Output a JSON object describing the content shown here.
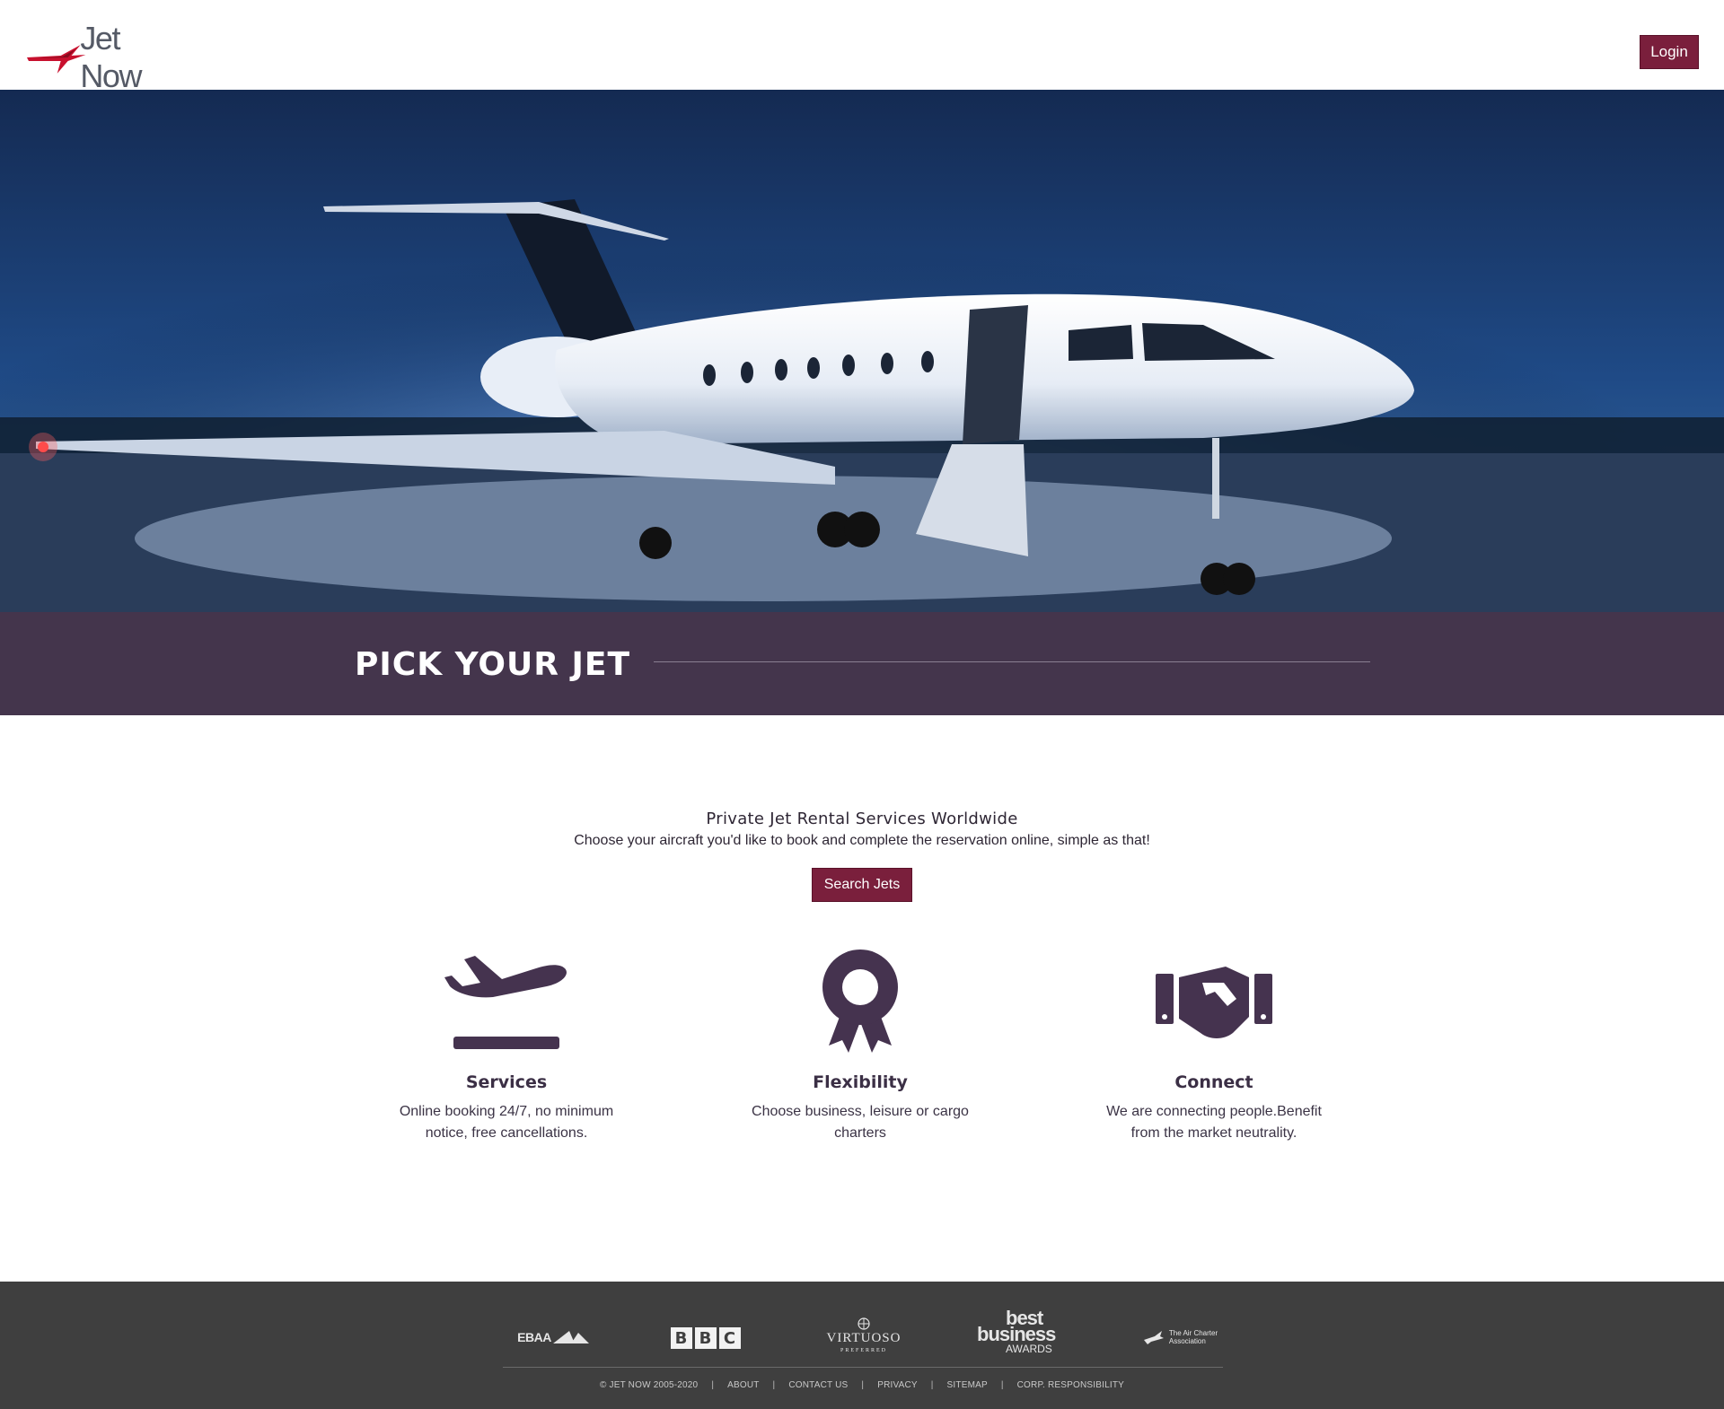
{
  "header": {
    "logo_text": "Jet Now",
    "login_label": "Login"
  },
  "band": {
    "title": "PICK YOUR JET"
  },
  "intro": {
    "title": "Private Jet Rental Services Worldwide",
    "subtitle": "Choose your aircraft you'd like to book and complete the reservation online, simple as that!",
    "search_label": "Search Jets"
  },
  "features": [
    {
      "icon": "airplane-departure-icon",
      "title": "Services",
      "desc": "Online booking 24/7, no minimum notice, free cancellations."
    },
    {
      "icon": "award-ribbon-icon",
      "title": "Flexibility",
      "desc": "Choose business, leisure or cargo charters"
    },
    {
      "icon": "handshake-icon",
      "title": "Connect",
      "desc": "We are connecting people.Benefit from the market neutrality."
    }
  ],
  "footer": {
    "partners": {
      "ebaa": "EBAA",
      "bbc": [
        "B",
        "B",
        "C"
      ],
      "virtuoso": "VIRTUOSO",
      "virtuoso_sub": "PREFERRED",
      "best_line1": "best",
      "best_line2": "business",
      "best_line3": "AWARDS",
      "aca_line1": "The Air Charter",
      "aca_line2": "Association"
    },
    "copyright": "© JET NOW 2005-2020",
    "links": [
      "ABOUT",
      "CONTACT US",
      "PRIVACY",
      "SITEMAP",
      "CORP. RESPONSIBILITY"
    ],
    "separator": "|"
  },
  "colors": {
    "brand_red": "#7a1f3c",
    "band_purple": "#44354c",
    "footer_gray": "#3f3f3f"
  }
}
